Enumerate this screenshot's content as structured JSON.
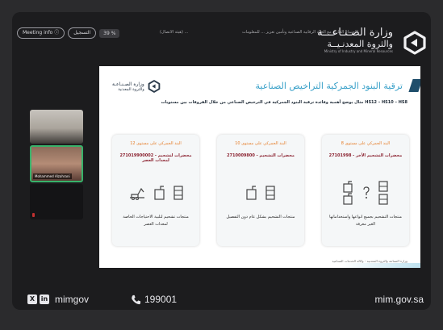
{
  "meeting": {
    "info_label": "Meeting info ⓘ",
    "record_label": "التسجيل",
    "percent": "39 %",
    "notice_left": "(هيئة الاتصال) ...",
    "notice_right": "الاجتماع الجاري مع الجهة الرقابية الصناعية وتأمين تعزيز ... للمعلومات"
  },
  "logo": {
    "line1": "وزارة الصـنـاعـــة",
    "line2": "والثروة المعدنـيــة",
    "line3": "Ministry of Industry and Mineral Resources"
  },
  "participants": [
    {
      "name": ""
    },
    {
      "name": "Mohammed Alzahrani"
    },
    {
      "name": ""
    }
  ],
  "slide": {
    "logo_line1": "وزارة الصـنـاعـة",
    "logo_line2": "والثروة المعدنية",
    "title": "ترقية البنود الجمركية التراخيص الصناعية",
    "subtitle": "مثال يوضح أهمية وفائدة ترقية البنود الجمركية في الترخيص الصناعي من خلال الفروقات بين مستويات HS12 – HS10 – HS8",
    "cards": [
      {
        "heading": "البند الجمركي على مستوى 12",
        "code": "271019900002 - محضرات لتشحيم لمعدات العصر",
        "footer": "منتجات تشحيم لتلبية الاحتياجات الخاصة لمعدات العصر"
      },
      {
        "heading": "البند الجمركي على مستوى 10",
        "code": "2710009800 - محضرات التشحيم",
        "footer": "منتجات التشحيم بشكل عام دون التفصيل"
      },
      {
        "heading": "البند الجمركي على مستوى 8",
        "code": "27101998 - محضرات التشحيم الأخر",
        "footer": "منتجات التشحيم بجميع انواعها واستخداماتها الغير معرفة"
      }
    ],
    "footer_note": "وزارة الصناعة والثروة المعدنية - وكالة الخدمات الصناعية"
  },
  "footer": {
    "x_icon": "X",
    "linkedin_icon": "in",
    "handle": "mimgov",
    "phone": "199001",
    "url": "mim.gov.sa"
  },
  "colors": {
    "background": "#2b2b2d",
    "title_blue": "#3aa1c9",
    "heading_orange": "#e57b26",
    "code_red": "#8b2230",
    "active_speaker": "#38b26a"
  }
}
